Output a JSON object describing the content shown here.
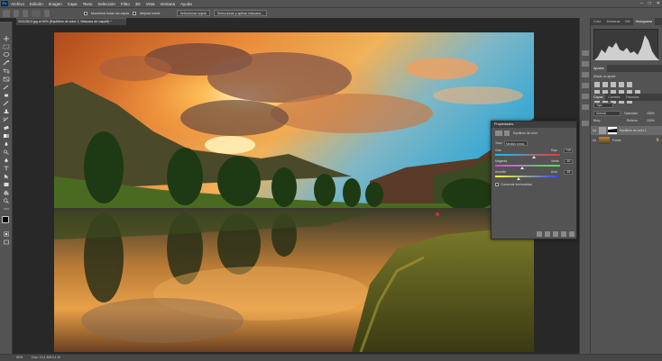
{
  "menubar": {
    "logo": "Ps",
    "items": [
      "Archivo",
      "Edición",
      "Imagen",
      "Capa",
      "Texto",
      "Selección",
      "Filtro",
      "3D",
      "Vista",
      "Ventana",
      "Ayuda"
    ],
    "window_controls": [
      "–",
      "□",
      "✕"
    ]
  },
  "options": {
    "sample_all_layers": "Muestrear todas las capas",
    "enhance_edge": "Mejorar borde",
    "select_subject": "Seleccionar sujeto",
    "select_and_mask": "Seleccionar y aplicar máscara..."
  },
  "document": {
    "tab_title": "20412613.jpg al 50% (Equilibrio de color 1, Máscara de capa/8) *",
    "zoom": "50%",
    "doc_info": "Doc: 13,1 M/13,1 M"
  },
  "histogram_panel": {
    "tabs": [
      "Color",
      "Muestras",
      "Bib",
      "Histograma"
    ],
    "active": "Histograma"
  },
  "adjustments_panel": {
    "title": "Ajustes",
    "subtitle": "Añadir un ajuste"
  },
  "layers_panel": {
    "tabs": [
      "Capas",
      "Canales",
      "Trazados"
    ],
    "kind_label": "Tipo",
    "blend_mode": "Normal",
    "opacity_label": "Opacidad:",
    "opacity_value": "100%",
    "lock_label": "Bloq.:",
    "fill_label": "Relleno:",
    "fill_value": "100%",
    "layers": [
      {
        "name": "Equilibrio de color 1"
      },
      {
        "name": "Fondo"
      }
    ]
  },
  "properties_panel": {
    "title": "Propiedades",
    "adjustment_name": "Equilibrio de color",
    "tone_label": "Tono:",
    "tone_value": "Medios tonos",
    "sliders": [
      {
        "left": "Cian",
        "right": "Rojo",
        "value": "+19",
        "position": 0.6
      },
      {
        "left": "Magenta",
        "right": "Verde",
        "value": "-10",
        "position": 0.42
      },
      {
        "left": "Amarillo",
        "right": "Azul",
        "value": "-18",
        "position": 0.36
      }
    ],
    "preserve_luminosity": "Conservar luminosidad"
  },
  "colors": {
    "panel_bg": "#535353",
    "canvas_bg": "#282828",
    "accent": "#31a8ff"
  }
}
